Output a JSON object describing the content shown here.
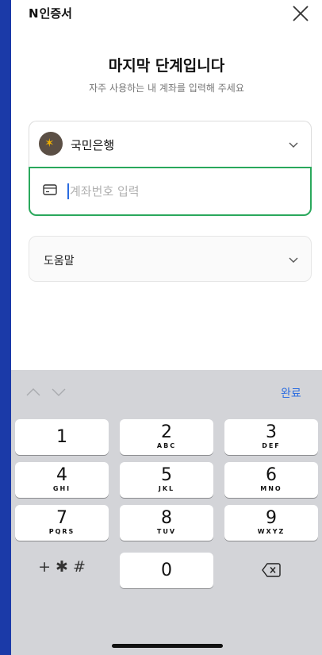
{
  "header": {
    "app_name_mark": "N",
    "app_name": "인증서",
    "close_icon": "close-icon"
  },
  "title": "마지막 단계입니다",
  "subtitle": "자주 사용하는 내 계좌를 입력해 주세요",
  "bank_select": {
    "selected_bank": "국민은행",
    "logo_glyph": "✶",
    "brand_color": "#f2b200"
  },
  "account_field": {
    "value": "",
    "placeholder": "계좌번호 입력",
    "focus_color": "#2aa85c"
  },
  "help": {
    "label": "도움말"
  },
  "keyboard": {
    "done_label": "완료",
    "keys": [
      {
        "num": "1",
        "letters": ""
      },
      {
        "num": "2",
        "letters": "ABC"
      },
      {
        "num": "3",
        "letters": "DEF"
      },
      {
        "num": "4",
        "letters": "GHI"
      },
      {
        "num": "5",
        "letters": "JKL"
      },
      {
        "num": "6",
        "letters": "MNO"
      },
      {
        "num": "7",
        "letters": "PQRS"
      },
      {
        "num": "8",
        "letters": "TUV"
      },
      {
        "num": "9",
        "letters": "WXYZ"
      }
    ],
    "symbols_label": "+ ✱ #",
    "zero": "0"
  },
  "colors": {
    "accent": "#2f6fe0",
    "frame": "#1b3aa8"
  }
}
